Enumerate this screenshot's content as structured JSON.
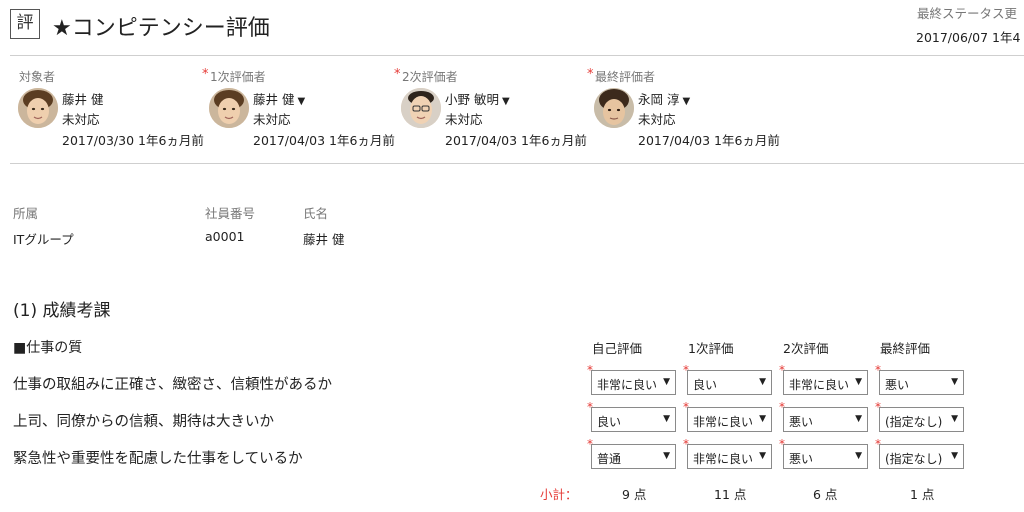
{
  "header": {
    "icon_char": "評",
    "title": "★コンピテンシー評価",
    "status_label": "最終ステータス更",
    "status_date": "2017/06/07 1年4"
  },
  "evaluators": [
    {
      "role": "対象者",
      "required": false,
      "name": "藤井 健",
      "has_dropdown": false,
      "status": "未対応",
      "date": "2017/03/30 1年6ヵ月前"
    },
    {
      "role": "1次評価者",
      "required": true,
      "name": "藤井 健",
      "has_dropdown": true,
      "status": "未対応",
      "date": "2017/04/03 1年6ヵ月前"
    },
    {
      "role": "2次評価者",
      "required": true,
      "name": "小野 敏明",
      "has_dropdown": true,
      "status": "未対応",
      "date": "2017/04/03 1年6ヵ月前"
    },
    {
      "role": "最終評価者",
      "required": true,
      "name": "永岡 淳",
      "has_dropdown": true,
      "status": "未対応",
      "date": "2017/04/03 1年6ヵ月前"
    }
  ],
  "employee": {
    "dept_label": "所属",
    "dept_value": "ITグループ",
    "id_label": "社員番号",
    "id_value": "a0001",
    "name_label": "氏名",
    "name_value": "藤井 健"
  },
  "section": {
    "title": "(1) 成績考課",
    "subheading": "■仕事の質",
    "columns": [
      "自己評価",
      "1次評価",
      "2次評価",
      "最終評価"
    ],
    "rows": [
      {
        "question": "仕事の取組みに正確さ、緻密さ、信頼性があるか",
        "values": [
          "非常に良い",
          "良い",
          "非常に良い",
          "悪い"
        ]
      },
      {
        "question": "上司、同僚からの信頼、期待は大きいか",
        "values": [
          "良い",
          "非常に良い",
          "悪い",
          "(指定なし)"
        ]
      },
      {
        "question": "緊急性や重要性を配慮した仕事をしているか",
        "values": [
          "普通",
          "非常に良い",
          "悪い",
          "(指定なし)"
        ]
      }
    ],
    "subtotal_label": "小計：",
    "subtotals": [
      "9 点",
      "11 点",
      "6 点",
      "1 点"
    ]
  },
  "glyphs": {
    "required": "*",
    "dropdown_caret": "▼"
  },
  "icons": {
    "avatar": "person-photo",
    "title": "evaluation-badge-icon"
  }
}
